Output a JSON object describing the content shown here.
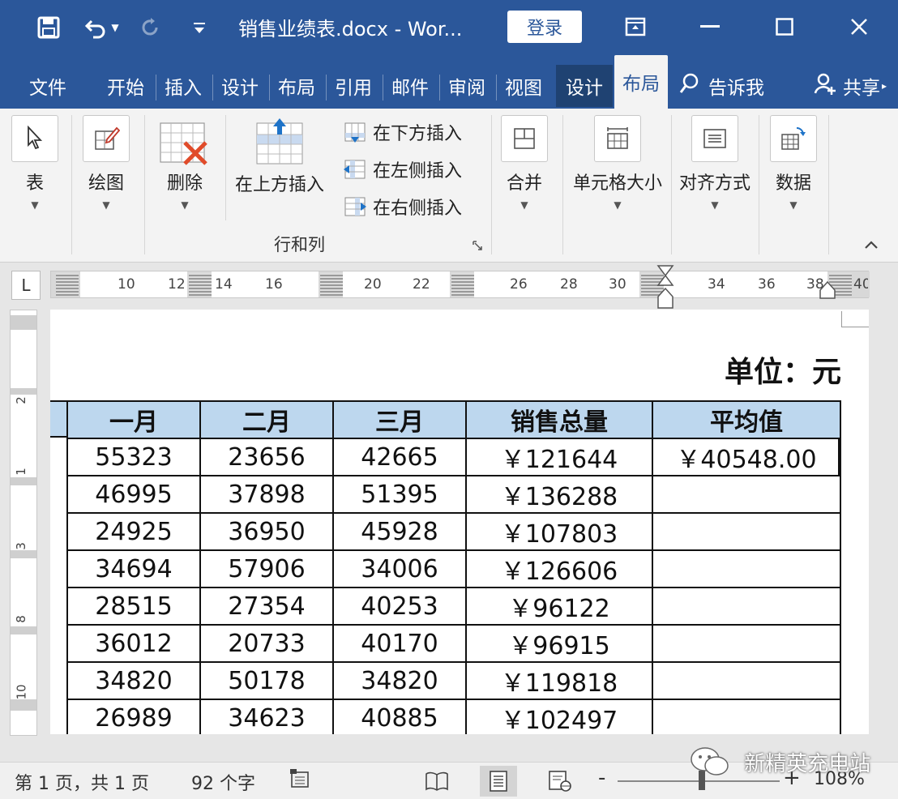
{
  "titlebar": {
    "doc_title": "销售业绩表.docx  -  Wor...",
    "login_label": "登录"
  },
  "tabs": [
    {
      "label": "文件"
    },
    {
      "label": "开始"
    },
    {
      "label": "插入"
    },
    {
      "label": "设计"
    },
    {
      "label": "布局"
    },
    {
      "label": "引用"
    },
    {
      "label": "邮件"
    },
    {
      "label": "审阅"
    },
    {
      "label": "视图"
    },
    {
      "label": "设计"
    },
    {
      "label": "布局"
    },
    {
      "label": "告诉我"
    },
    {
      "label": "共享"
    }
  ],
  "ribbon": {
    "table_label": "表",
    "draw_label": "绘图",
    "delete_label": "删除",
    "insert_above_label": "在上方插入",
    "insert_below_label": "在下方插入",
    "insert_left_label": "在左侧插入",
    "insert_right_label": "在右侧插入",
    "merge_label": "合并",
    "cell_size_label": "单元格大小",
    "alignment_label": "对齐方式",
    "data_label": "数据",
    "group_label": "行和列"
  },
  "ruler": {
    "corner": "L",
    "h_ticks": [
      "10",
      "12",
      "14",
      "16",
      "20",
      "22",
      "26",
      "28",
      "30",
      "34",
      "36",
      "38",
      "40"
    ],
    "v_ticks": [
      "2",
      "1",
      "3",
      "8",
      "10"
    ]
  },
  "document": {
    "unit_label": "单位：元",
    "headers": [
      "一月",
      "二月",
      "三月",
      "销售总量",
      "平均值"
    ],
    "rows": [
      [
        "55323",
        "23656",
        "42665",
        "￥121644",
        "￥40548.00"
      ],
      [
        "46995",
        "37898",
        "51395",
        "￥136288",
        ""
      ],
      [
        "24925",
        "36950",
        "45928",
        "￥107803",
        ""
      ],
      [
        "34694",
        "57906",
        "34006",
        "￥126606",
        ""
      ],
      [
        "28515",
        "27354",
        "40253",
        "￥96122",
        ""
      ],
      [
        "36012",
        "20733",
        "40170",
        "￥96915",
        ""
      ],
      [
        "34820",
        "50178",
        "34820",
        "￥119818",
        ""
      ],
      [
        "26989",
        "34623",
        "40885",
        "￥102497",
        ""
      ]
    ]
  },
  "statusbar": {
    "page_info": "第 1 页，共 1 页",
    "word_count": "92 个字",
    "zoom_minus": "-",
    "zoom_plus": "+",
    "zoom_level": "108%",
    "zoom_fraction": 0.52
  },
  "watermark": "新精英充电站",
  "colors": {
    "accent": "#2b579a",
    "header_fill": "#bdd7ee"
  }
}
